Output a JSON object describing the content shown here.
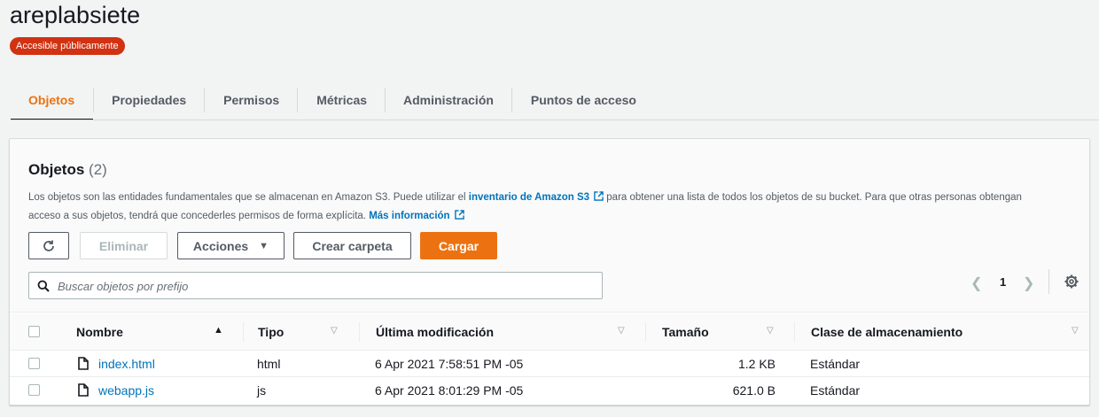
{
  "bucket": {
    "name": "areplabsiete",
    "badge": "Accesible públicamente",
    "badge_color": "#d13212"
  },
  "tabs": [
    {
      "label": "Objetos",
      "active": true
    },
    {
      "label": "Propiedades",
      "active": false
    },
    {
      "label": "Permisos",
      "active": false
    },
    {
      "label": "Métricas",
      "active": false
    },
    {
      "label": "Administración",
      "active": false
    },
    {
      "label": "Puntos de acceso",
      "active": false
    }
  ],
  "objects_panel": {
    "title": "Objetos",
    "count": "(2)",
    "description": {
      "part1": "Los objetos son las entidades fundamentales que se almacenan en Amazon S3. Puede utilizar el ",
      "link1": "inventario de Amazon S3",
      "part2": " para obtener una lista de todos los objetos de su bucket. Para que otras personas obtengan acceso a sus objetos, tendrá que concederles permisos de forma explícita. ",
      "link2": "Más información"
    },
    "buttons": {
      "refresh_icon": "refresh-icon",
      "delete": "Eliminar",
      "actions": "Acciones",
      "create_folder": "Crear carpeta",
      "upload": "Cargar"
    },
    "search": {
      "placeholder": "Buscar objetos por prefijo",
      "value": ""
    },
    "pagination": {
      "page": "1"
    },
    "columns": [
      "Nombre",
      "Tipo",
      "Última modificación",
      "Tamaño",
      "Clase de almacenamiento"
    ],
    "rows": [
      {
        "name": "index.html",
        "type": "html",
        "modified": "6 Apr 2021 7:58:51 PM -05",
        "size": "1.2 KB",
        "storage_class": "Estándar"
      },
      {
        "name": "webapp.js",
        "type": "js",
        "modified": "6 Apr 2021 8:01:29 PM -05",
        "size": "621.0 B",
        "storage_class": "Estándar"
      }
    ]
  },
  "colors": {
    "accent": "#ec7211",
    "link": "#0073bb"
  }
}
